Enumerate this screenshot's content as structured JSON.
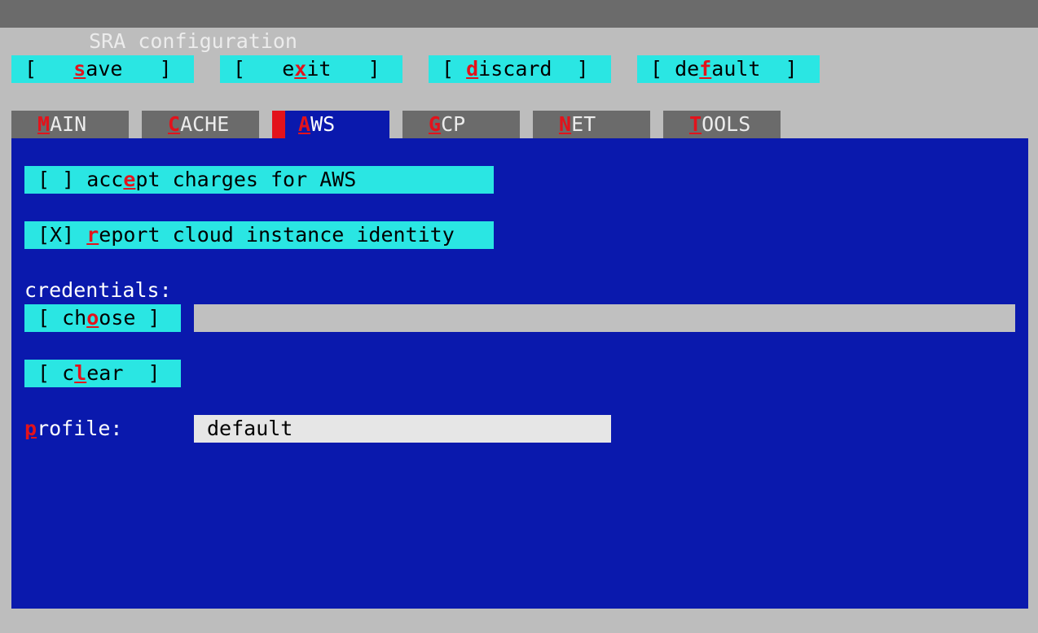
{
  "window": {
    "title": "SRA configuration"
  },
  "actions": [
    {
      "name": "save-button",
      "pre": "[   ",
      "key": "s",
      "post": "ave   ]"
    },
    {
      "name": "exit-button",
      "pre": "[   e",
      "key": "x",
      "post": "it   ]"
    },
    {
      "name": "discard-button",
      "pre": "[ ",
      "key": "d",
      "post": "iscard  ]"
    },
    {
      "name": "default-button",
      "pre": "[ de",
      "key": "f",
      "post": "ault  ]"
    }
  ],
  "tabs": [
    {
      "name": "tab-main",
      "key": "M",
      "rest": "AIN"
    },
    {
      "name": "tab-cache",
      "key": "C",
      "rest": "ACHE"
    },
    {
      "name": "tab-aws",
      "key": "A",
      "rest": "WS",
      "active": true
    },
    {
      "name": "tab-gcp",
      "key": "G",
      "rest": "CP"
    },
    {
      "name": "tab-net",
      "key": "N",
      "rest": "ET"
    },
    {
      "name": "tab-tools",
      "key": "T",
      "rest": "OOLS"
    }
  ],
  "aws": {
    "accept_charges": {
      "pre": "[ ] acc",
      "key": "e",
      "post": "pt charges for AWS"
    },
    "report_identity": {
      "pre": "[X] ",
      "key": "r",
      "post": "eport cloud instance identity"
    },
    "credentials_label": "credentials:",
    "credentials_value": "",
    "choose_button": {
      "pre": "[ ch",
      "key": "o",
      "post": "ose ]"
    },
    "clear_button": {
      "pre": "[ c",
      "key": "l",
      "post": "ear  ]"
    },
    "profile_label": {
      "key": "p",
      "post": "rofile:"
    },
    "profile_value": "default"
  },
  "colors": {
    "title_bar": "#6b6b6b",
    "background": "#bdbdbd",
    "panel": "#0a19ad",
    "button": "#2ae6e3",
    "hotkey": "#e3121b",
    "field": "#c0c0c0",
    "field_focused": "#e6e6e6"
  }
}
